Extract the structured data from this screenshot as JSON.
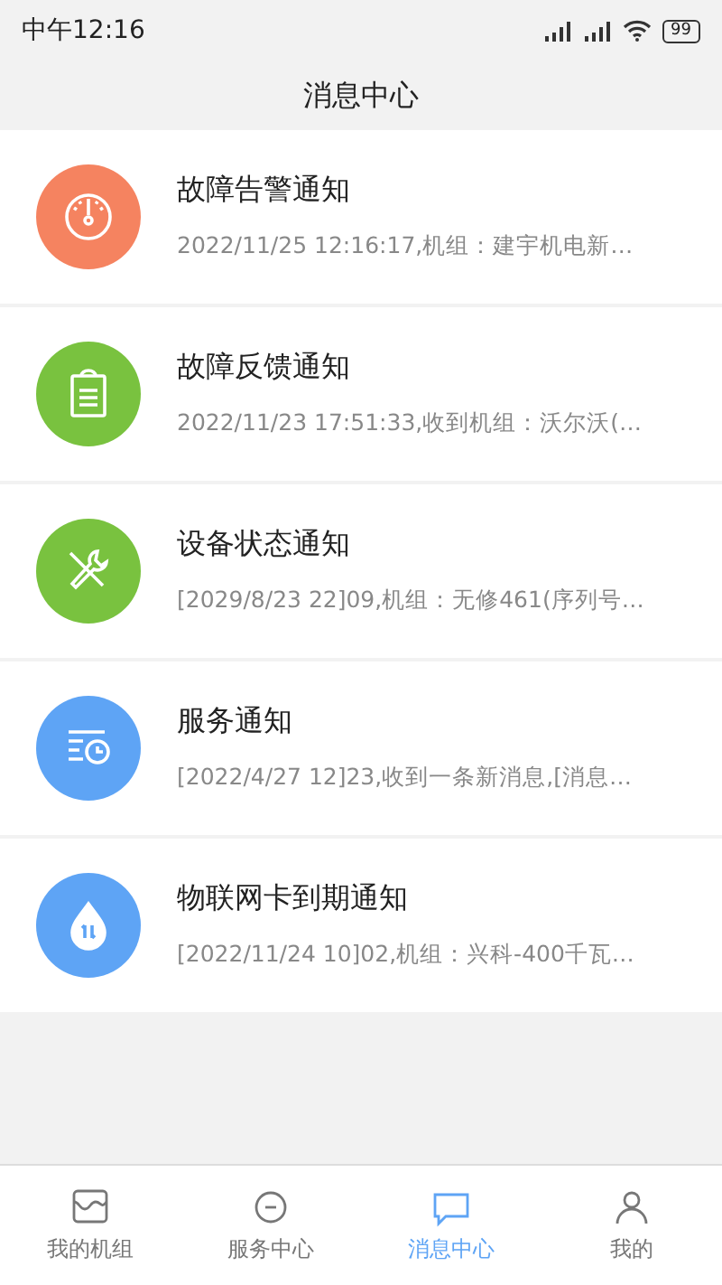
{
  "status_bar": {
    "time": "中午12:16",
    "battery": "99"
  },
  "header": {
    "title": "消息中心"
  },
  "messages": [
    {
      "kind": "gauge",
      "color": "#f58360",
      "title": "故障告警通知",
      "preview": "2022/11/25 12:16:17,机组：建宇机电新…"
    },
    {
      "kind": "clipboard",
      "color": "#79c23f",
      "title": "故障反馈通知",
      "preview": "2022/11/23 17:51:33,收到机组：沃尔沃(…"
    },
    {
      "kind": "tools",
      "color": "#79c23f",
      "title": "设备状态通知",
      "preview": "[2029/8/23 22]09,机组：无修461(序列号…"
    },
    {
      "kind": "clock",
      "color": "#5ea4f5",
      "title": "服务通知",
      "preview": "[2022/4/27 12]23,收到一条新消息,[消息…"
    },
    {
      "kind": "drop",
      "color": "#5ea4f5",
      "title": "物联网卡到期通知",
      "preview": "[2022/11/24 10]02,机组：兴科-400千瓦…"
    }
  ],
  "tabs": [
    {
      "kind": "units",
      "label": "我的机组",
      "selected": false
    },
    {
      "kind": "service",
      "label": "服务中心",
      "selected": false
    },
    {
      "kind": "message",
      "label": "消息中心",
      "selected": true
    },
    {
      "kind": "me",
      "label": "我的",
      "selected": false
    }
  ]
}
